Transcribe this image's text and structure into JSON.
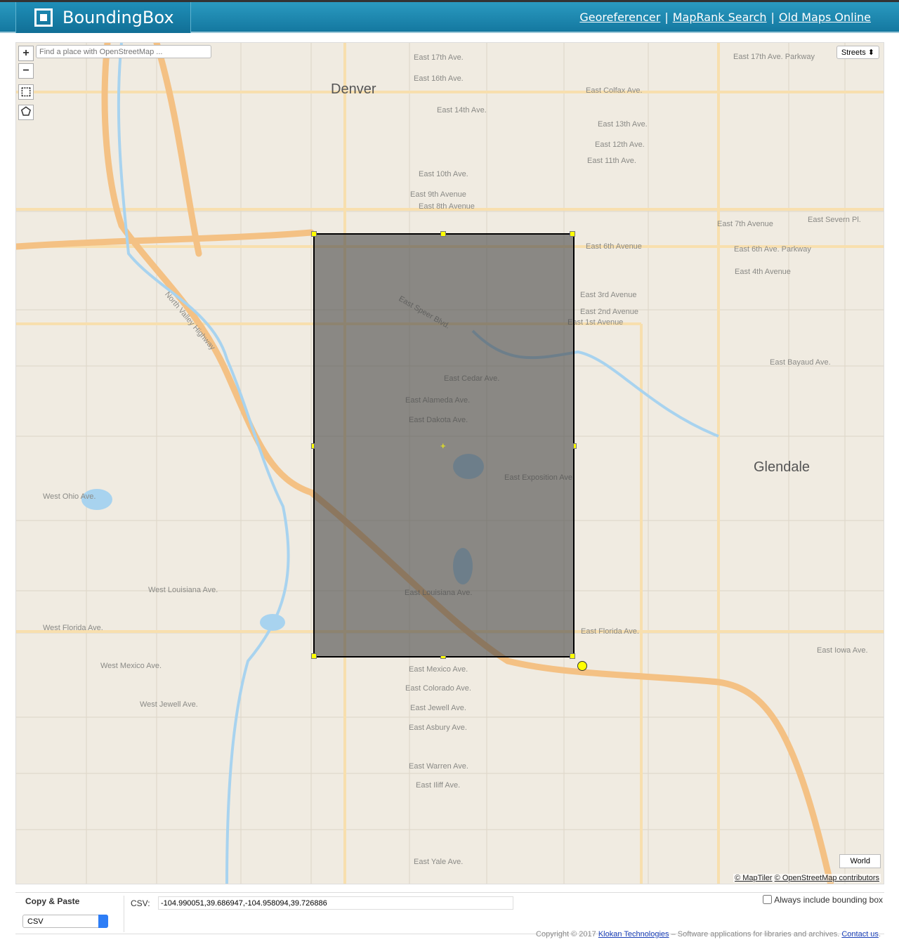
{
  "header": {
    "title": "BoundingBox",
    "nav": [
      "Georeferencer",
      "MapRank Search",
      "Old Maps Online"
    ]
  },
  "map": {
    "zoom_in": "+",
    "zoom_out": "−",
    "search_placeholder": "Find a place with OpenStreetMap ...",
    "layer": "Streets",
    "world": "World",
    "attribution": [
      "© MapTiler",
      "© OpenStreetMap contributors"
    ],
    "labels": [
      "Denver",
      "Glendale",
      "East 17th Ave.",
      "East 16th Ave.",
      "East Colfax Ave.",
      "East 14th Ave.",
      "East 13th Ave.",
      "East 12th Ave.",
      "East 11th Ave.",
      "East 10th Ave.",
      "East 9th Avenue",
      "East 8th Avenue",
      "East 7th Avenue",
      "East 6th Avenue",
      "East 4th Avenue",
      "East 3rd Avenue",
      "East 2nd Avenue",
      "East 1st Avenue",
      "East Bayaud Ave.",
      "East Cedar Ave.",
      "East Alameda Ave.",
      "East Dakota Ave.",
      "East Exposition Ave",
      "West Ohio Ave.",
      "West Louisiana Ave.",
      "East Louisiana Ave.",
      "West Florida Ave.",
      "East Florida Ave.",
      "East Iowa Ave.",
      "West Mexico Ave.",
      "East Mexico Ave.",
      "East Colorado Ave.",
      "West Jewell Ave.",
      "East Jewell Ave.",
      "East Asbury Ave.",
      "East Warren Ave.",
      "East Iliff Ave.",
      "East Yale Ave.",
      "East 17th Ave. Parkway",
      "East Severn Pl.",
      "East 6th Ave. Parkway",
      "North Valley Highway",
      "East Speer Blvd."
    ],
    "colors": {
      "background": "#f0ebe1",
      "highway": "#f6c98b",
      "water": "#a8d3ef",
      "selection": "#464646",
      "handle": "#ffff00"
    }
  },
  "panel": {
    "title": "Copy & Paste",
    "format": "CSV",
    "csv_label": "CSV:",
    "csv_value": "-104.990051,39.686947,-104.958094,39.726886",
    "always_label": "Always include bounding box"
  },
  "footer": {
    "copyright": "Copyright © 2017 ",
    "company": "Klokan Technologies",
    "tagline": " – Software applications for libraries and archives. ",
    "contact": "Contact us",
    "end": "."
  }
}
